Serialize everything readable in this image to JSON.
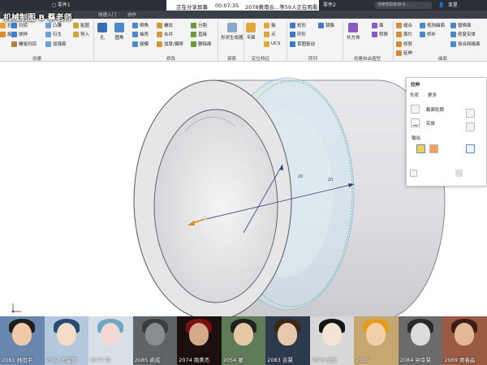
{
  "title_bar": {
    "doc_name": "零件1",
    "share_status": "正在分享屏幕",
    "timer": "00:07:35",
    "viewers_text": "2078黄南云...等59人正在观看",
    "search_placeholder": "搜索帮助和命令...",
    "user_name": "亚星",
    "window_label": "零件2"
  },
  "watermark": "机械制图 B 蔡老师",
  "tabs": [
    "快速入门",
    "协作"
  ],
  "ribbon": {
    "create": {
      "group_label": "创建",
      "buttons": [
        "拉伸",
        "旋转",
        "扫掠",
        "放样",
        "螺旋扫掠",
        "凸雕",
        "衍生",
        "加强筋",
        "贴图",
        "导入"
      ]
    },
    "modify": {
      "group_label": "修改",
      "buttons": [
        "孔",
        "圆角",
        "倒角",
        "抽壳",
        "拔模",
        "螺纹",
        "合并",
        "加厚/偏移",
        "分割",
        "直接",
        "删除面"
      ]
    },
    "explore": {
      "group_label": "探索",
      "buttons": [
        "形状生成器"
      ]
    },
    "work_features": {
      "group_label": "定位特征",
      "buttons": [
        "平面",
        "轴",
        "点",
        "UCS"
      ]
    },
    "pattern": {
      "group_label": "阵列",
      "buttons": [
        "矩形",
        "环形",
        "草图驱动",
        "镜像"
      ]
    },
    "freeform": {
      "group_label": "创建自由造型",
      "buttons": [
        "长方体",
        "面",
        "转换"
      ]
    },
    "surface": {
      "group_label": "曲面",
      "buttons": [
        "缝合",
        "面片",
        "修剪",
        "延伸",
        "规则曲面",
        "修补",
        "替换面",
        "修复实体",
        "拟合网格面"
      ]
    }
  },
  "extrude_panel": {
    "title": "拉伸",
    "tabs": [
      "形状",
      "更多"
    ],
    "profile_label": "截面轮廓",
    "solid_label": "实体",
    "output_label": "输出"
  },
  "viewport": {
    "dimension_labels": [
      "20",
      "20"
    ]
  },
  "participants": [
    {
      "name": "2081 林阳平",
      "bg": "#6a87b0",
      "skin": "#f1c9a9",
      "hair": "#1d1d1d"
    },
    {
      "name": "2082 王留哲",
      "bg": "#b4c8dd",
      "skin": "#f4dcc8",
      "hair": "#2c4b72"
    },
    {
      "name": "2077 琴",
      "bg": "#d8dfe6",
      "skin": "#f3d9d3",
      "hair": "#6ea8c9"
    },
    {
      "name": "2085 姚成",
      "bg": "#5f6468",
      "skin": "#8a8d8f",
      "hair": "#3a3d40"
    },
    {
      "name": "2074 周美杰",
      "bg": "#1b0f0f",
      "skin": "#d3a98c",
      "hair": "#7a0f0f"
    },
    {
      "name": "2054 翟",
      "bg": "#5f7b57",
      "skin": "#e6c7a6",
      "hair": "#20201f"
    },
    {
      "name": "2083 吉慧",
      "bg": "#2d3a4e",
      "skin": "#e8c7ad",
      "hair": "#3c2618"
    },
    {
      "name": "2076 安立",
      "bg": "#d8d8d8",
      "skin": "#f4e4d5",
      "hair": "#151515"
    },
    {
      "name": "2035 ",
      "bg": "#c7a770",
      "skin": "#f1d0a9",
      "hair": "#e59b1e"
    },
    {
      "name": "2084 钟幸慧",
      "bg": "#6b6b6b",
      "skin": "#dcdcdc",
      "hair": "#2a2a2a"
    },
    {
      "name": "2069 贾春晶",
      "bg": "#9a5a44",
      "skin": "#e3b896",
      "hair": "#3d1e15"
    }
  ]
}
